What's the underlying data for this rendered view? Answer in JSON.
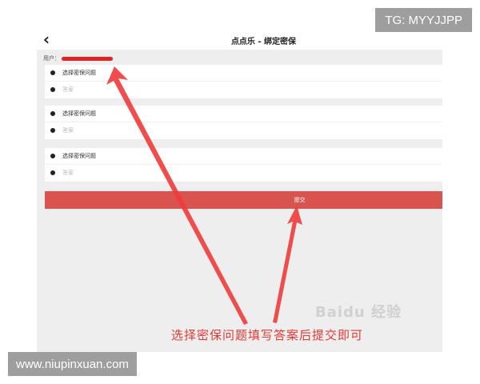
{
  "header": {
    "back_icon": "chevron-left-icon",
    "title": "点点乐 - 绑定密保"
  },
  "user": {
    "label": "用户："
  },
  "security_questions": [
    {
      "question": "选择密保问题",
      "answer_placeholder": "答案"
    },
    {
      "question": "选择密保问题",
      "answer_placeholder": "答案"
    },
    {
      "question": "选择密保问题",
      "answer_placeholder": "答案"
    }
  ],
  "submit": {
    "label": "提交"
  },
  "overlay": {
    "annotation": "选择密保问题填写答案后提交即可",
    "baidu_watermark": "Baidu 经验",
    "tg_watermark": "TG: MYYJJPP",
    "site_watermark": "www.niupinxuan.com"
  },
  "colors": {
    "submit_button": "#d9534f",
    "annotation": "#e53935",
    "screen_background": "#eeeeee"
  }
}
